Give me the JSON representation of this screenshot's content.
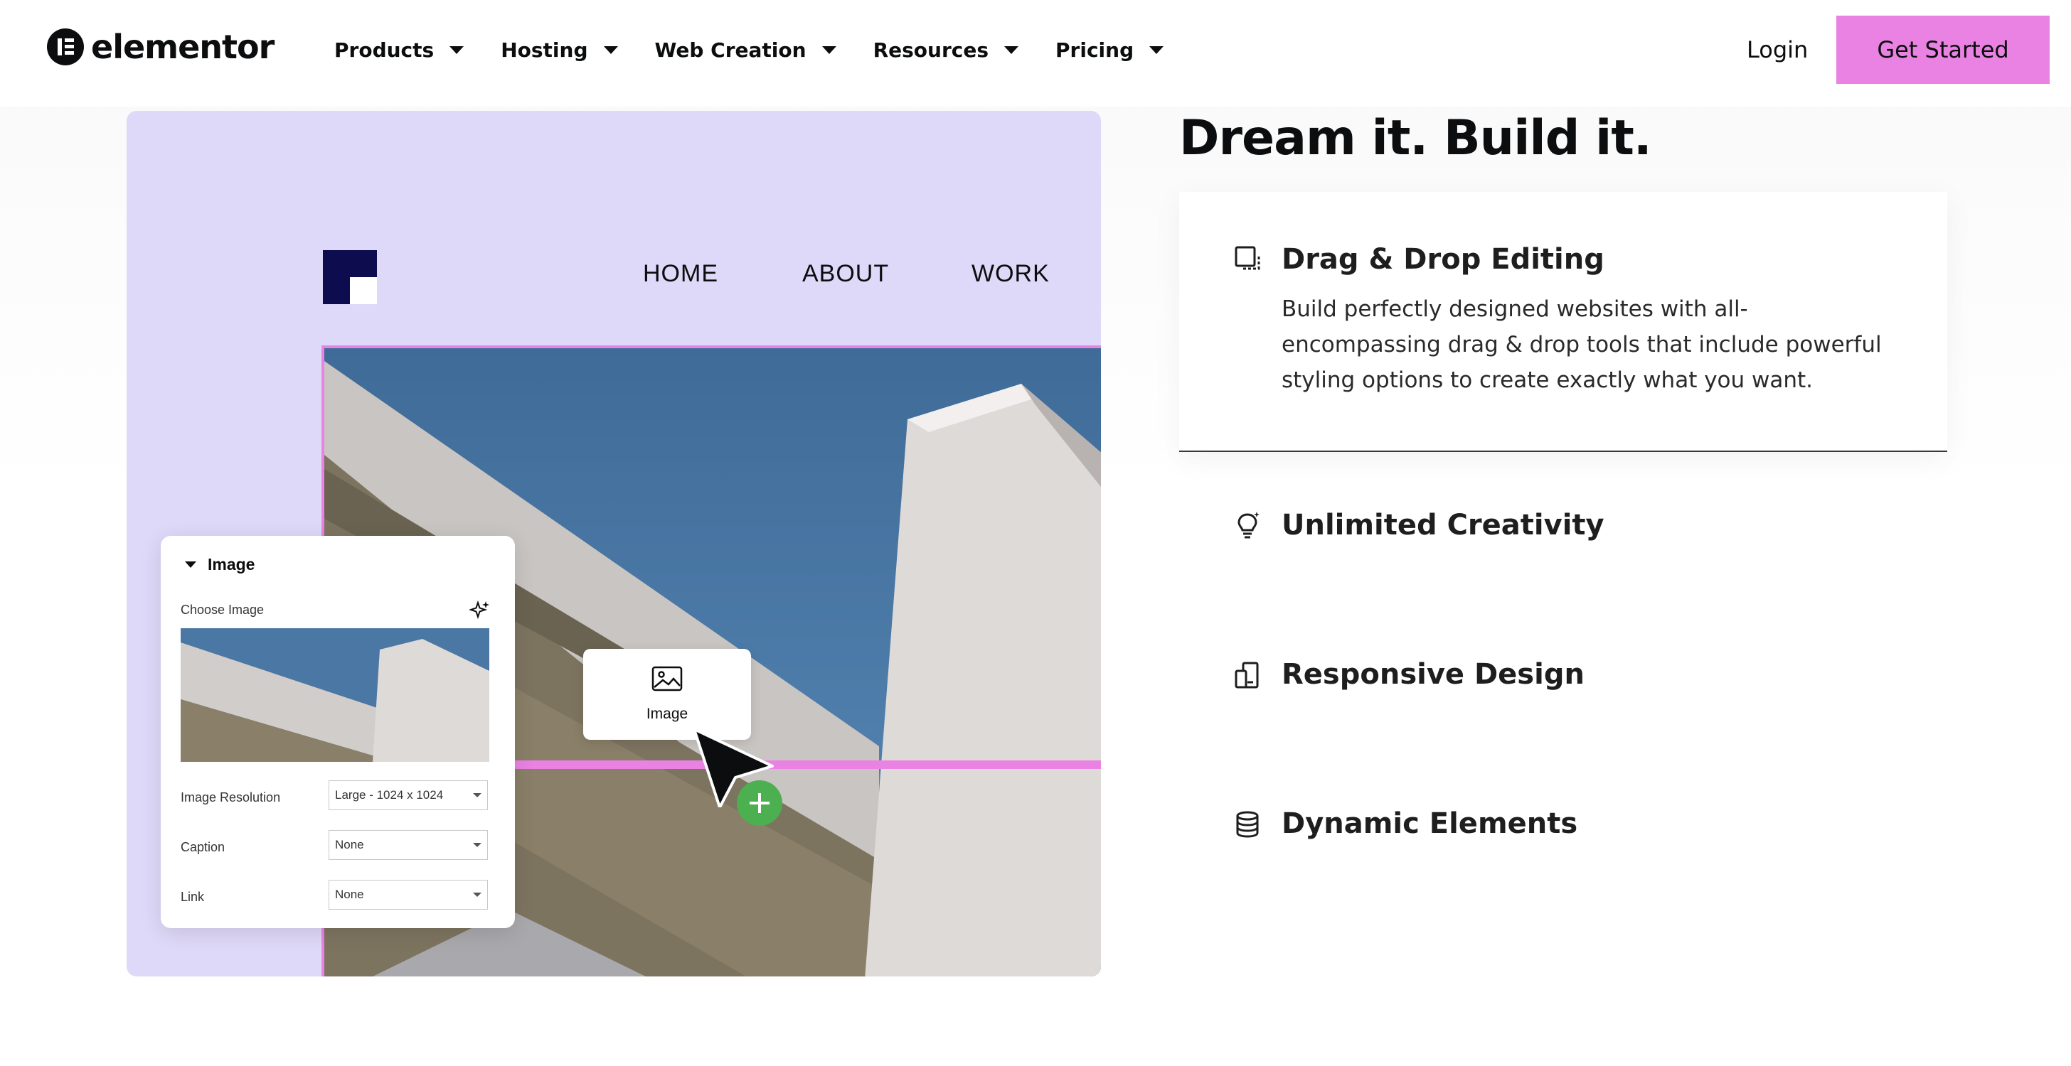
{
  "header": {
    "logo_text": "elementor",
    "nav": [
      {
        "label": "Products"
      },
      {
        "label": "Hosting"
      },
      {
        "label": "Web Creation"
      },
      {
        "label": "Resources"
      },
      {
        "label": "Pricing"
      }
    ],
    "login_label": "Login",
    "cta_label": "Get Started"
  },
  "demo": {
    "site_nav": [
      "HOME",
      "ABOUT",
      "WORK"
    ],
    "panel": {
      "title": "Image",
      "choose_label": "Choose Image",
      "rows": [
        {
          "label": "Image Resolution",
          "value": "Large - 1024 x 1024"
        },
        {
          "label": "Caption",
          "value": "None"
        },
        {
          "label": "Link",
          "value": "None"
        }
      ]
    },
    "widget_label": "Image"
  },
  "main": {
    "headline": "Dream it. Build it.",
    "features": [
      {
        "title": "Drag & Drop Editing",
        "icon": "drag-drop-icon",
        "description": "Build perfectly designed websites with all-encompassing drag & drop tools that include powerful styling options to create exactly what you want.",
        "expanded": true
      },
      {
        "title": "Unlimited Creativity",
        "icon": "lightbulb-icon",
        "expanded": false
      },
      {
        "title": "Responsive Design",
        "icon": "devices-icon",
        "expanded": false
      },
      {
        "title": "Dynamic Elements",
        "icon": "database-icon",
        "expanded": false
      }
    ]
  },
  "colors": {
    "accent_pink": "#ea82e3",
    "demo_background": "#dfd9f9",
    "plus_green": "#4caf50",
    "text_dark": "#0c0d0e"
  }
}
